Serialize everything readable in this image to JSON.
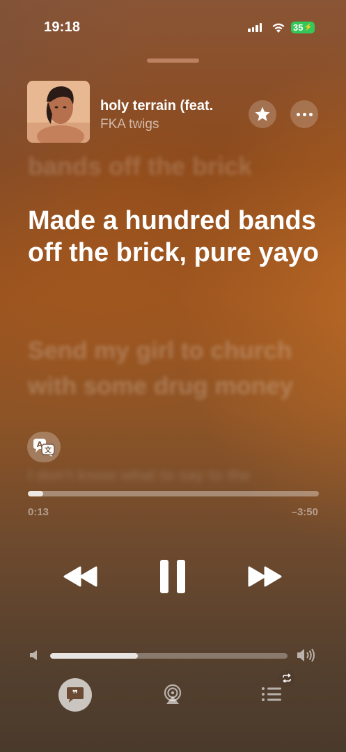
{
  "status_bar": {
    "time": "19:18",
    "battery_level": "35",
    "battery_color": "#34c759"
  },
  "now_playing": {
    "title": "holy terrain (feat.",
    "artist": "FKA twigs",
    "artwork_icon": "album-artwork"
  },
  "lyrics": {
    "previous": "bands off the brick",
    "current": "Made a hundred bands off the brick, pure yayo",
    "next": "Send my girl to church with some drug money",
    "after_next": "I don't know what to say to the"
  },
  "playback": {
    "elapsed": "0:13",
    "remaining": "–3:50",
    "progress_fraction": 0.053,
    "is_playing": true
  },
  "volume": {
    "level_fraction": 0.37
  },
  "bottom_bar": {
    "lyrics_icon": "quote-bubble-icon",
    "airplay_icon": "airplay-icon",
    "queue_icon": "queue-list-icon",
    "repeat_icon": "repeat-icon"
  }
}
